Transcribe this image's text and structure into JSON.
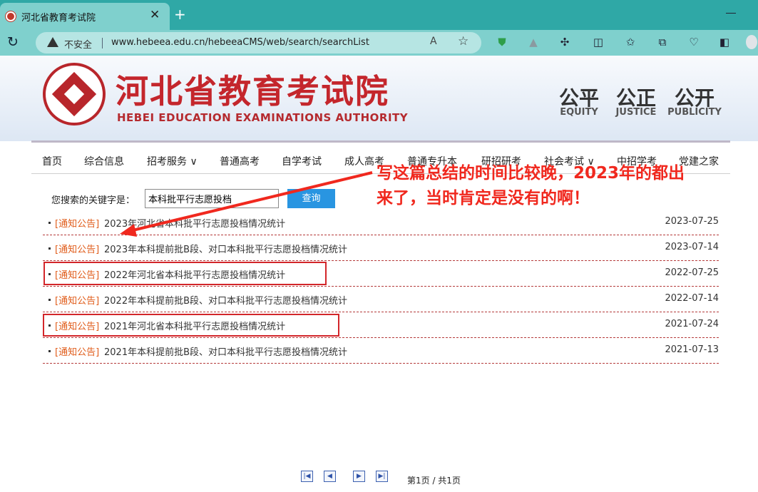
{
  "browser": {
    "tab_title": "河北省教育考试院",
    "tab_close": "✕",
    "new_tab": "+",
    "reload": "↻",
    "insecure_label": "不安全",
    "url": "www.hebeea.edu.cn/hebeeaCMS/web/search/searchList",
    "read_aloud": "A",
    "favorite": "☆"
  },
  "header": {
    "site_name_cn": "河北省教育考试院",
    "site_name_en": "HEBEI EDUCATION EXAMINATIONS AUTHORITY",
    "mottos": [
      {
        "cn": "公平",
        "en": "EQUITY"
      },
      {
        "cn": "公正",
        "en": "JUSTICE"
      },
      {
        "cn": "公开",
        "en": "PUBLICITY"
      }
    ]
  },
  "nav": {
    "items": [
      "首页",
      "综合信息",
      "招考服务 ∨",
      "普通高考",
      "自学考试",
      "成人高考",
      "普通专升本",
      "研招研考",
      "社会考试 ∨",
      "中招学考",
      "党建之家"
    ]
  },
  "search": {
    "label": "您搜索的关键字是：",
    "value": "本科批平行志愿投档",
    "button": "查询"
  },
  "results": [
    {
      "tag": "[通知公告]",
      "title": "2023年河北省本科批平行志愿投档情况统计",
      "date": "2023-07-25"
    },
    {
      "tag": "[通知公告]",
      "title": "2023年本科提前批B段、对口本科批平行志愿投档情况统计",
      "date": "2023-07-14"
    },
    {
      "tag": "[通知公告]",
      "title": "2022年河北省本科批平行志愿投档情况统计",
      "date": "2022-07-25"
    },
    {
      "tag": "[通知公告]",
      "title": "2022年本科提前批B段、对口本科批平行志愿投档情况统计",
      "date": "2022-07-14"
    },
    {
      "tag": "[通知公告]",
      "title": "2021年河北省本科批平行志愿投档情况统计",
      "date": "2021-07-24"
    },
    {
      "tag": "[通知公告]",
      "title": "2021年本科提前批B段、对口本科批平行志愿投档情况统计",
      "date": "2021-07-13"
    }
  ],
  "annotation": {
    "line1": "写这篇总结的时间比较晚，2023年的都出",
    "line2": "来了，当时肯定是没有的啊！"
  },
  "pager": {
    "first": "|◀",
    "prev": "◀",
    "next": "▶",
    "last": "▶|",
    "info": "第1页 / 共1页"
  },
  "colors": {
    "brand_red": "#c4262c",
    "tab_teal": "#2fa8a6",
    "button_blue": "#2995e1",
    "tag_orange": "#e05c1a",
    "annotation_red": "#f0281e"
  }
}
